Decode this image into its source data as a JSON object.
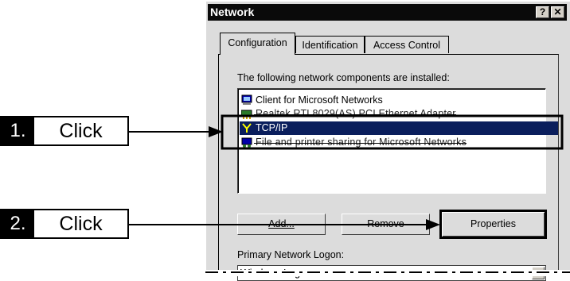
{
  "dialog": {
    "title": "Network",
    "help_glyph": "?",
    "close_glyph": "✕",
    "tabs": [
      "Configuration",
      "Identification",
      "Access Control"
    ],
    "components_label": "The following network components are installed:",
    "components": [
      {
        "label": "Client for Microsoft Networks",
        "icon": "network-client-icon"
      },
      {
        "label": "Realtek RTL8029(AS) PCI Ethernet Adapter",
        "icon": "network-adapter-icon"
      },
      {
        "label": "TCP/IP",
        "icon": "protocol-icon",
        "selected": true
      },
      {
        "label": "File and printer sharing for Microsoft Networks",
        "icon": "file-sharing-service-icon"
      }
    ],
    "buttons": {
      "add": "Add...",
      "remove": "Remove",
      "properties": "Properties"
    },
    "logon_label": "Primary Network Logon:",
    "logon_value": "Windows Logon",
    "dropdown_glyph": "▼"
  },
  "callouts": [
    {
      "number": "1.",
      "text": "Click"
    },
    {
      "number": "2.",
      "text": "Click"
    }
  ],
  "colors": {
    "selection": "#0a1e5c",
    "dialog_bg": "#dcdcdc",
    "title_bar": "#0a0a0a"
  }
}
